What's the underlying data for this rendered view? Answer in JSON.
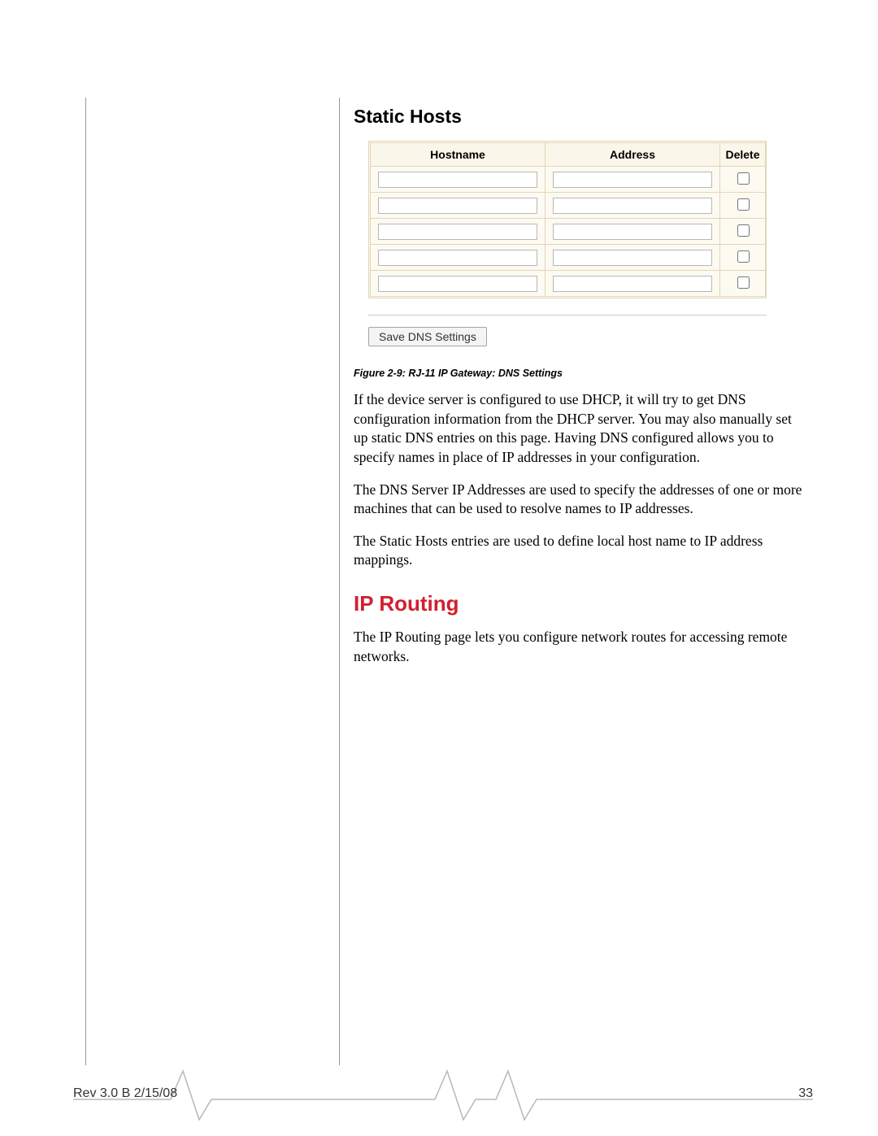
{
  "static_hosts": {
    "heading": "Static Hosts",
    "columns": {
      "hostname": "Hostname",
      "address": "Address",
      "delete": "Delete"
    },
    "row_count": 5,
    "save_button": "Save DNS Settings"
  },
  "figure_caption": "Figure 2-9:  RJ-11 IP Gateway: DNS Settings",
  "paragraphs": {
    "p1": "If the device server is configured to use DHCP, it will try to get DNS configuration information from the DHCP server. You may also manually set up static DNS entries on this page. Having DNS configured allows you to specify names in place of IP addresses in your configuration.",
    "p2": "The DNS Server IP Addresses are used to specify the addresses of one or more machines that can be used to resolve names to IP addresses.",
    "p3": "The Static Hosts entries are used to define local host name to IP address mappings."
  },
  "ip_routing": {
    "heading": "IP Routing",
    "p1": "The IP Routing page lets you configure network routes for accessing remote networks."
  },
  "footer": {
    "rev": "Rev 3.0 B  2/15/08",
    "page": "33"
  }
}
